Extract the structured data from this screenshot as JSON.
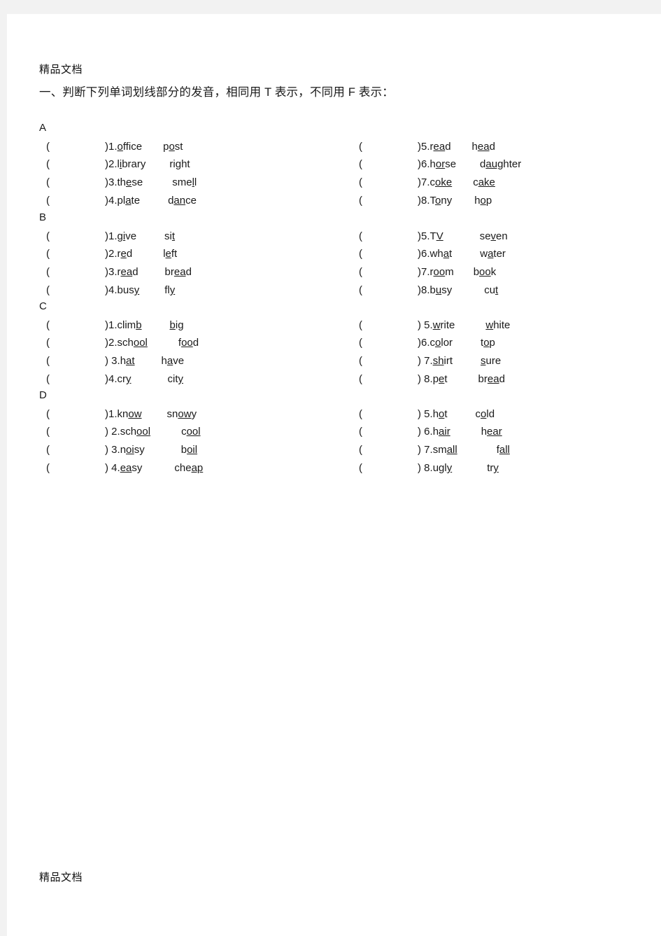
{
  "document": {
    "watermark_top": "精品文档",
    "watermark_bottom": "精品文档",
    "heading": "一、判断下列单词划线部分的发音，相同用 T 表示，不同用 F 表示："
  },
  "sections": [
    {
      "letter": "A",
      "left_rows": [
        {
          "paren_open": "(",
          "paren_close": ")",
          "number": "1.",
          "word1": "office",
          "word1_pre": "",
          "word1_under": "o",
          "word1_post": "ffice",
          "word2": "post",
          "word2_pre": "p",
          "word2_under": "o",
          "word2_post": "st",
          "gap1": "72px",
          "gap2": "30px"
        },
        {
          "paren_open": "(",
          "paren_close": ")",
          "number": "2.",
          "word1": "library",
          "word1_pre": "l",
          "word1_under": "i",
          "word1_post": "brary",
          "word2": "right",
          "word2_pre": "ri",
          "word2_under": "g",
          "word2_post": "ht",
          "gap1": "72px",
          "gap2": "34px"
        },
        {
          "paren_open": "(",
          "paren_close": ")",
          "number": "3.",
          "word1": "these",
          "word1_pre": "th",
          "word1_under": "e",
          "word1_post": "se",
          "word2": "smell",
          "word2_pre": "sme",
          "word2_under": "l",
          "word2_post": "l",
          "gap1": "72px",
          "gap2": "42px"
        },
        {
          "paren_open": "(",
          "paren_close": ")",
          "number": "4.",
          "word1": "plate",
          "word1_pre": "pl",
          "word1_under": "a",
          "word1_post": "te",
          "word2": "dance",
          "word2_pre": "d",
          "word2_under": "an",
          "word2_post": "ce",
          "gap1": "72px",
          "gap2": "40px"
        }
      ],
      "right_rows": [
        {
          "paren_open": "(",
          "paren_close": ")",
          "number": "5.",
          "word1": "read",
          "word1_pre": "r",
          "word1_under": "ea",
          "word1_post": "d",
          "word2": "head",
          "word2_pre": "h",
          "word2_under": "ea",
          "word2_post": "d",
          "gap1": "72px",
          "gap2": "30px"
        },
        {
          "paren_open": "(",
          "paren_close": ")",
          "number": "6.",
          "word1": "horse",
          "word1_pre": "h",
          "word1_under": "or",
          "word1_post": "se",
          "word2": "daughter",
          "word2_pre": "d",
          "word2_under": "aug",
          "word2_post": "hter",
          "gap1": "72px",
          "gap2": "34px"
        },
        {
          "paren_open": "(",
          "paren_close": ")",
          "number": "7.",
          "word1": "coke",
          "word1_pre": "c",
          "word1_under": "oke",
          "word1_post": "",
          "word2": "cake",
          "word2_pre": "c",
          "word2_under": "ake",
          "word2_post": "",
          "gap1": "72px",
          "gap2": "30px"
        },
        {
          "paren_open": "(",
          "paren_close": ")",
          "number": "8.",
          "word1": "Tony",
          "word1_pre": "T",
          "word1_under": "o",
          "word1_post": "ny",
          "word2": "hop",
          "word2_pre": "h",
          "word2_under": "o",
          "word2_post": "p",
          "gap1": "72px",
          "gap2": "32px"
        }
      ]
    },
    {
      "letter": "B",
      "left_rows": [
        {
          "paren_open": "(",
          "paren_close": ")",
          "number": "1.",
          "word1": "give",
          "word1_pre": "g",
          "word1_under": "i",
          "word1_post": "ve",
          "word2": "sit",
          "word2_pre": "si",
          "word2_under": "t",
          "word2_post": "",
          "gap1": "72px",
          "gap2": "40px"
        },
        {
          "paren_open": "(",
          "paren_close": ")",
          "number": "2.",
          "word1": "red",
          "word1_pre": "r",
          "word1_under": "e",
          "word1_post": "d",
          "word2": "left",
          "word2_pre": "l",
          "word2_under": "e",
          "word2_post": "ft",
          "gap1": "72px",
          "gap2": "44px"
        },
        {
          "paren_open": "(",
          "paren_close": ")",
          "number": "3.",
          "word1": "read",
          "word1_pre": "r",
          "word1_under": "ea",
          "word1_post": "d",
          "word2": "bread",
          "word2_pre": "br",
          "word2_under": "ea",
          "word2_post": "d",
          "gap1": "72px",
          "gap2": "38px"
        },
        {
          "paren_open": "(",
          "paren_close": ")",
          "number": "4.",
          "word1": "busy",
          "word1_pre": "bus",
          "word1_under": "y",
          "word1_post": "",
          "word2": "fly",
          "word2_pre": "fl",
          "word2_under": "y",
          "word2_post": "",
          "gap1": "72px",
          "gap2": "36px"
        }
      ],
      "right_rows": [
        {
          "paren_open": "(",
          "paren_close": ")",
          "number": "5.",
          "word1": "TV",
          "word1_pre": "T",
          "word1_under": "V",
          "word1_post": "",
          "word2": "seven",
          "word2_pre": "se",
          "word2_under": "v",
          "word2_post": "en",
          "gap1": "72px",
          "gap2": "52px"
        },
        {
          "paren_open": "(",
          "paren_close": ")",
          "number": "6.",
          "word1": "what",
          "word1_pre": "wh",
          "word1_under": "a",
          "word1_post": "t",
          "word2": "water",
          "word2_pre": "w",
          "word2_under": "a",
          "word2_post": "ter",
          "gap1": "72px",
          "gap2": "40px"
        },
        {
          "paren_open": "(",
          "paren_close": ")",
          "number": "7.",
          "word1": "room",
          "word1_pre": "r",
          "word1_under": "oo",
          "word1_post": "m",
          "word2": "book",
          "word2_pre": "b",
          "word2_under": "oo",
          "word2_post": "k",
          "gap1": "72px",
          "gap2": "28px"
        },
        {
          "paren_open": "(",
          "paren_close": ")",
          "number": "8.",
          "word1": "busy",
          "word1_pre": "b",
          "word1_under": "u",
          "word1_post": "sy",
          "word2": "cut",
          "word2_pre": "cu",
          "word2_under": "t",
          "word2_post": "",
          "gap1": "72px",
          "gap2": "46px"
        }
      ]
    },
    {
      "letter": "C",
      "left_rows": [
        {
          "paren_open": "(",
          "paren_close": ")",
          "number": "1.",
          "word1": "climb",
          "word1_pre": "clim",
          "word1_under": "b",
          "word1_post": "",
          "word2": "big",
          "word2_pre": "",
          "word2_under": "b",
          "word2_post": "ig",
          "gap1": "72px",
          "gap2": "40px"
        },
        {
          "paren_open": "(",
          "paren_close": ")",
          "number": "2.",
          "word1": "school",
          "word1_pre": "sch",
          "word1_under": "ool",
          "word1_post": "",
          "word2": "food",
          "word2_pre": "f",
          "word2_under": "oo",
          "word2_post": "d",
          "gap1": "72px",
          "gap2": "44px"
        },
        {
          "paren_open": "(",
          "paren_close": ") ",
          "number": "3.",
          "word1": "hat",
          "word1_pre": "h",
          "word1_under": "at",
          "word1_post": "",
          "word2": "have",
          "word2_pre": "h",
          "word2_under": "a",
          "word2_post": "ve",
          "gap1": "72px",
          "gap2": "38px"
        },
        {
          "paren_open": "(",
          "paren_close": ")",
          "number": "4.",
          "word1": "cry",
          "word1_pre": "cr",
          "word1_under": "y",
          "word1_post": "",
          "word2": "city",
          "word2_pre": "cit",
          "word2_under": "y",
          "word2_post": "",
          "gap1": "72px",
          "gap2": "52px"
        }
      ],
      "right_rows": [
        {
          "paren_open": "(",
          "paren_close": ") ",
          "number": "5.",
          "word1": "write",
          "word1_pre": "",
          "word1_under": "w",
          "word1_post": "rite",
          "word2": "white",
          "word2_pre": "",
          "word2_under": "w",
          "word2_post": "hite",
          "gap1": "72px",
          "gap2": "44px"
        },
        {
          "paren_open": "(",
          "paren_close": ")",
          "number": "6.",
          "word1": "color",
          "word1_pre": "c",
          "word1_under": "o",
          "word1_post": "lor",
          "word2": "top",
          "word2_pre": "t",
          "word2_under": "o",
          "word2_post": "p",
          "gap1": "72px",
          "gap2": "40px"
        },
        {
          "paren_open": "(",
          "paren_close": ") ",
          "number": "7.",
          "word1": "shirt",
          "word1_pre": "",
          "word1_under": "sh",
          "word1_post": "irt",
          "word2": "sure",
          "word2_pre": "",
          "word2_under": "s",
          "word2_post": "ure",
          "gap1": "72px",
          "gap2": "40px"
        },
        {
          "paren_open": "(",
          "paren_close": ") ",
          "number": "8.",
          "word1": "pet",
          "word1_pre": "p",
          "word1_under": "e",
          "word1_post": "t",
          "word2": "bread",
          "word2_pre": "br",
          "word2_under": "ea",
          "word2_post": "d",
          "gap1": "72px",
          "gap2": "44px"
        }
      ]
    },
    {
      "letter": "D",
      "left_rows": [
        {
          "paren_open": "(",
          "paren_close": ")",
          "number": "1.",
          "word1": "know",
          "word1_pre": "kn",
          "word1_under": "ow",
          "word1_post": "",
          "word2": "snowy",
          "word2_pre": "sn",
          "word2_under": "ow",
          "word2_post": "y",
          "gap1": "72px",
          "gap2": "36px"
        },
        {
          "paren_open": "(",
          "paren_close": ") ",
          "number": "2.",
          "word1": "school",
          "word1_pre": "sch",
          "word1_under": "ool",
          "word1_post": "",
          "word2": "cool",
          "word2_pre": "c",
          "word2_under": "ool",
          "word2_post": "",
          "gap1": "72px",
          "gap2": "44px"
        },
        {
          "paren_open": "(",
          "paren_close": ") ",
          "number": "3.",
          "word1": "noisy",
          "word1_pre": "n",
          "word1_under": "oi",
          "word1_post": "sy",
          "word2": "boil",
          "word2_pre": "b",
          "word2_under": "oil",
          "word2_post": "",
          "gap1": "72px",
          "gap2": "52px"
        },
        {
          "paren_open": "(",
          "paren_close": ") ",
          "number": "4.",
          "word1": "easy",
          "word1_pre": "",
          "word1_under": "ea",
          "word1_post": "sy",
          "word2": "cheap",
          "word2_pre": "che",
          "word2_under": "ap",
          "word2_post": "",
          "gap1": "72px",
          "gap2": "46px"
        }
      ],
      "right_rows": [
        {
          "paren_open": "(",
          "paren_close": ") ",
          "number": "5.",
          "word1": "hot",
          "word1_pre": "h",
          "word1_under": "o",
          "word1_post": "t",
          "word2": "cold",
          "word2_pre": "c",
          "word2_under": "o",
          "word2_post": "ld",
          "gap1": "72px",
          "gap2": "40px"
        },
        {
          "paren_open": "(",
          "paren_close": ") ",
          "number": "6.",
          "word1": "hair",
          "word1_pre": "h",
          "word1_under": "air",
          "word1_post": "",
          "word2": "hear",
          "word2_pre": "h",
          "word2_under": "ear",
          "word2_post": "",
          "gap1": "72px",
          "gap2": "44px"
        },
        {
          "paren_open": "(",
          "paren_close": ") ",
          "number": "7.",
          "word1": "small",
          "word1_pre": "sm",
          "word1_under": "all",
          "word1_post": "",
          "word2": "fall",
          "word2_pre": "f",
          "word2_under": "all",
          "word2_post": "",
          "gap1": "72px",
          "gap2": "56px"
        },
        {
          "paren_open": "(",
          "paren_close": ") ",
          "number": "8.",
          "word1": "ugly",
          "word1_pre": "ugl",
          "word1_under": "y",
          "word1_post": "",
          "word2": "try",
          "word2_pre": "tr",
          "word2_under": "y",
          "word2_post": "",
          "gap1": "72px",
          "gap2": "50px"
        }
      ]
    }
  ],
  "layout": {
    "section_tops": [
      155,
      283,
      410,
      537
    ],
    "row_offsets": [
      26,
      51,
      77,
      103
    ]
  }
}
